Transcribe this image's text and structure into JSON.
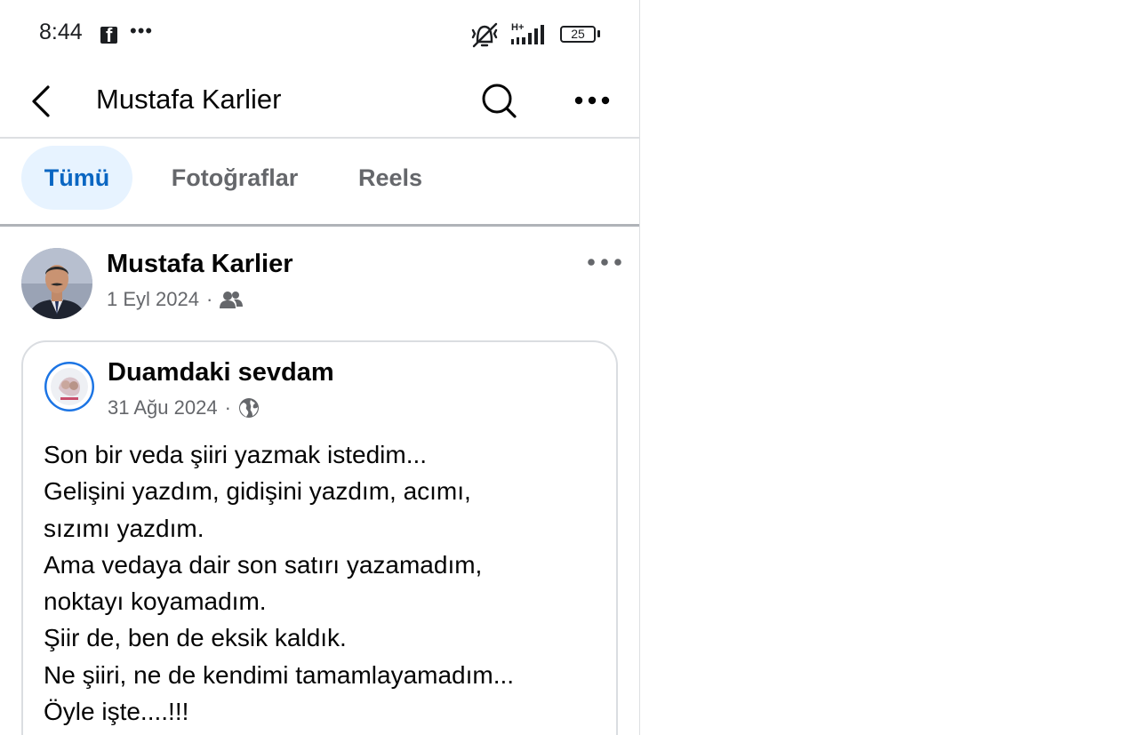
{
  "status_bar": {
    "time": "8:44",
    "dots": "•••",
    "network_label": "H+",
    "battery": "25"
  },
  "header": {
    "title": "Mustafa Karlier"
  },
  "tabs": [
    {
      "label": "Tümü",
      "active": true
    },
    {
      "label": "Fotoğraflar",
      "active": false
    },
    {
      "label": "Reels",
      "active": false
    }
  ],
  "post": {
    "author": "Mustafa Karlier",
    "date": "1 Eyl 2024",
    "separator": "·",
    "audience_icon": "friends-icon",
    "shared": {
      "page_name": "Duamdaki sevdam",
      "date": "31 Ağu 2024",
      "separator": "·",
      "audience_icon": "globe-icon",
      "lines": [
        "Son bir veda şiiri yazmak istedim...",
        "Gelişini yazdım, gidişini yazdım, acımı,",
        "sızımı yazdım.",
        "Ama vedaya dair son satırı yazamadım,",
        "noktayı koyamadım.",
        "Şiir de, ben de eksik kaldık.",
        "Ne şiiri, ne de kendimi tamamlayamadım...",
        "Öyle işte....!!!"
      ]
    }
  },
  "colors": {
    "accent": "#0a66c2",
    "accent_bg": "#e7f3ff",
    "secondary_text": "#65676b",
    "divider": "#dddfe2"
  }
}
